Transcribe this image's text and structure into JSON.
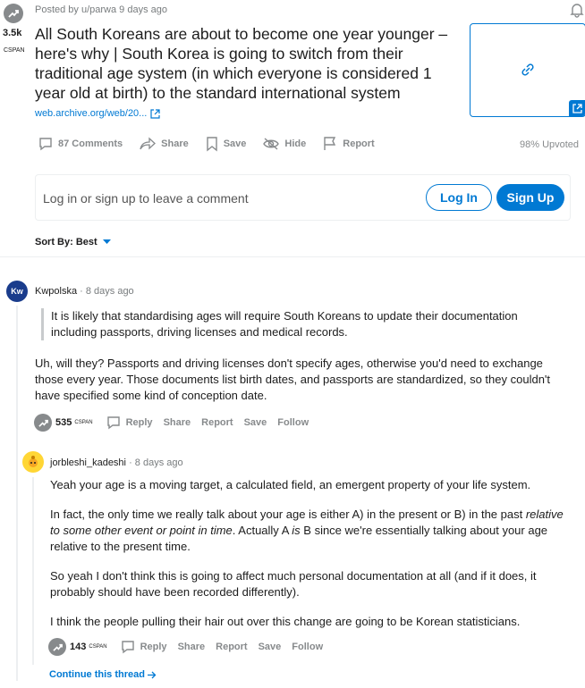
{
  "post": {
    "score": "3.5k",
    "award_label": "CSPAN",
    "posted_by": "Posted by u/parwa 9 days ago",
    "title": "All South Koreans are about to become one year younger – here's why | South Korea is going to switch from their traditional age system (in which everyone is considered 1 year old at birth) to the standard international system",
    "link_text": "web.archive.org/web/20...",
    "actions": {
      "comments": "87 Comments",
      "share": "Share",
      "save": "Save",
      "hide": "Hide",
      "report": "Report"
    },
    "upvoted": "98% Upvoted"
  },
  "login": {
    "prompt": "Log in or sign up to leave a comment",
    "login_label": "Log In",
    "signup_label": "Sign Up"
  },
  "sort": {
    "label": "Sort By: Best"
  },
  "comments": [
    {
      "avatar_text": "Kw",
      "author": "Kwpolska",
      "time": "· 8 days ago",
      "quote": "It is likely that standardising ages will require South Koreans to update their documentation including passports, driving licenses and medical records.",
      "body": "Uh, will they? Passports and driving licenses don't specify ages, otherwise you'd need to exchange those every year. Those documents list birth dates, and passports are standardized, so they couldn't have specified some kind of conception date.",
      "score": "535",
      "award": "CSPAN",
      "actions": [
        "Reply",
        "Share",
        "Report",
        "Save",
        "Follow"
      ]
    },
    {
      "author": "jorbleshi_kadeshi",
      "time": "· 8 days ago",
      "p1": "Yeah your age is a moving target, a calculated field, an emergent property of your life system.",
      "p2a": "In fact, the only time we really talk about your age is either A) in the present or B) in the past ",
      "p2b": "relative to some other event or point in time",
      "p2c": ". Actually A ",
      "p2d": "is",
      "p2e": " B since we're essentially talking about your age relative to the present time.",
      "p3": "So yeah I don't think this is going to affect much personal documentation at all (and if it does, it probably should have been recorded differently).",
      "p4": "I think the people pulling their hair out over this change are going to be Korean statisticians.",
      "score": "143",
      "award": "CSPAN",
      "actions": [
        "Reply",
        "Share",
        "Report",
        "Save",
        "Follow"
      ],
      "continue": "Continue this thread"
    }
  ],
  "colors": {
    "accent": "#0079d3",
    "muted": "#878a8c",
    "avatar_blue": "#1a3c8c"
  }
}
